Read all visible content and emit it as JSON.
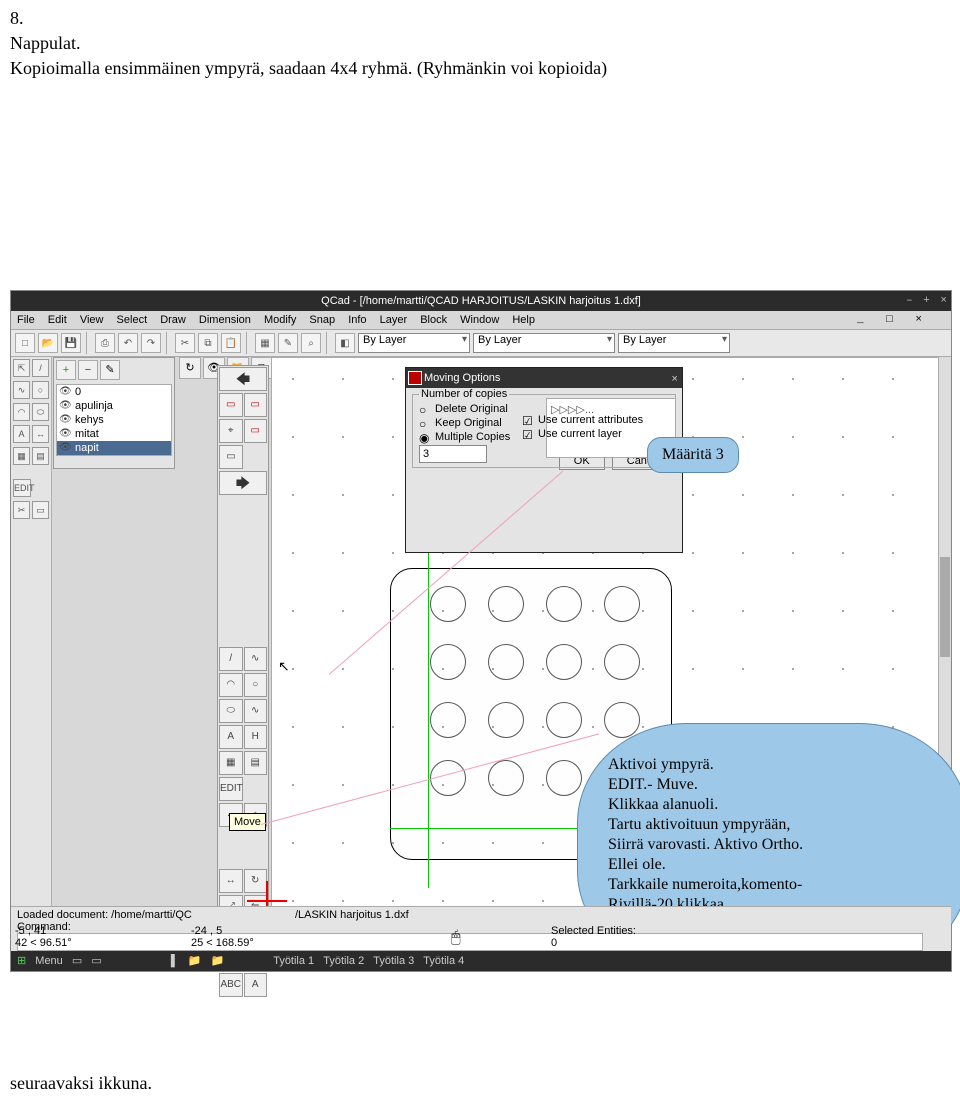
{
  "intro": {
    "num": "8.",
    "l1": "Nappulat.",
    "l2": "Kopioimalla ensimmäinen ympyrä, saadaan 4x4 ryhmä. (Ryhmänkin voi kopioida)"
  },
  "titlebar": "QCad - [/home/martti/QCAD HARJOITUS/LASKIN harjoitus 1.dxf]",
  "wctrl": [
    "–",
    "+",
    "×"
  ],
  "mdi": [
    "_",
    "□",
    "×"
  ],
  "menubar": [
    "File",
    "Edit",
    "View",
    "Select",
    "Draw",
    "Dimension",
    "Modify",
    "Snap",
    "Info",
    "Layer",
    "Block",
    "Window",
    "Help"
  ],
  "layerCombo": "By Layer",
  "linetypeCombo": "By Layer",
  "lineweightCombo": "By Layer",
  "layers": {
    "items": [
      {
        "name": "0"
      },
      {
        "name": "apulinja"
      },
      {
        "name": "kehys"
      },
      {
        "name": "mitat"
      },
      {
        "name": "napit",
        "selected": true
      }
    ]
  },
  "tooltip": "Move",
  "dialog": {
    "title": "Moving Options",
    "groupLabel": "Number of copies",
    "opts": {
      "del": "Delete Original",
      "keep": "Keep Original",
      "mult": "Multiple Copies"
    },
    "copies": "3",
    "preview": "▷▷▷▷...",
    "useAttr": "Use current attributes",
    "useLayer": "Use current layer",
    "ok": "OK",
    "cancel": "Cancel"
  },
  "cmd": {
    "loaded": "Loaded document: /home/martti/QC",
    "loaded2": "/LASKIN harjoitus 1.dxf",
    "cmdLabel": "Command:",
    "coordsL": "-5 , 41",
    "angleL": "42 < 96.51°",
    "coordsR": "-24 , 5",
    "angleR": "25 < 168.59°",
    "selLabel": "Selected Entities:",
    "selVal": "0"
  },
  "taskbar": {
    "menu": "Menu",
    "ws": [
      "Työtila 1",
      "Työtila 2",
      "Työtila 3",
      "Työtila 4"
    ]
  },
  "callout1": "Määritä 3",
  "callout2": {
    "l1": "Aktivoi ympyrä.",
    "l2": "EDIT.- Muve.",
    "l3": "Klikkaa alanuoli.",
    "l4": "Tartu aktivoituun ympyrään,",
    "l5": "Siirrä varovasti. Aktivo Ortho.",
    "l6": "Ellei ole.",
    "l7": "Tarkkaile numeroita,komento-",
    "l8": "Rivillä-20 klikkaa."
  },
  "footer": "seuraavaksi ikkuna."
}
